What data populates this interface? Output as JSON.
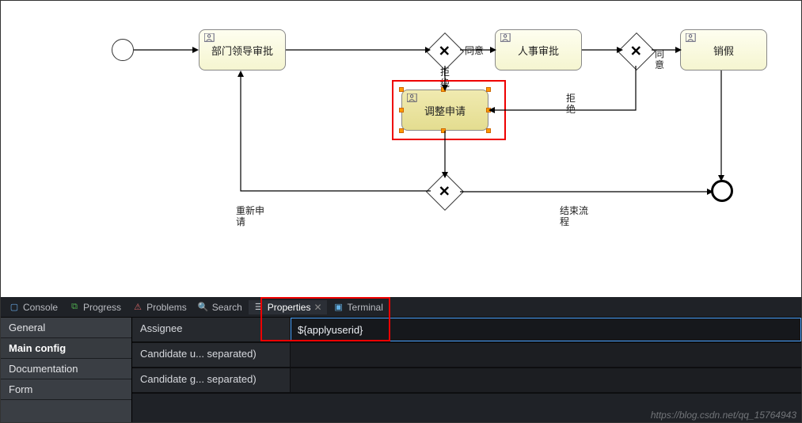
{
  "diagram": {
    "tasks": {
      "dept_approve": "部门领导审批",
      "hr_approve": "人事审批",
      "adjust_apply": "调整申请",
      "cancel_leave": "销假"
    },
    "edge_labels": {
      "agree1": "同意",
      "agree2": "同意",
      "reject1": "拒绝",
      "reject2": "拒绝",
      "reapply": "重新申请",
      "end_flow": "结束流程"
    }
  },
  "tabs": {
    "console": "Console",
    "progress": "Progress",
    "problems": "Problems",
    "search": "Search",
    "properties": "Properties",
    "terminal": "Terminal"
  },
  "side_tabs": {
    "general": "General",
    "main_config": "Main config",
    "documentation": "Documentation",
    "form": "Form"
  },
  "props": {
    "assignee_label": "Assignee",
    "assignee_value": "${applyuserid}",
    "candidate_users_label": "Candidate u... separated)",
    "candidate_users_value": "",
    "candidate_groups_label": "Candidate g... separated)",
    "candidate_groups_value": ""
  },
  "watermark": "https://blog.csdn.net/qq_15764943"
}
